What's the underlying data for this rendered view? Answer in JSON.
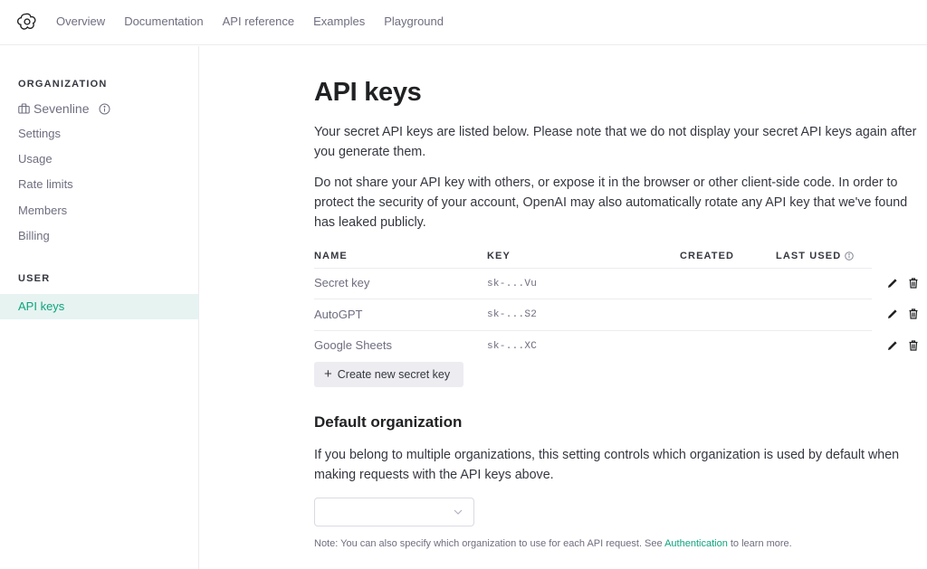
{
  "topbar": {
    "logo": "openai-logo-icon",
    "nav": [
      "Overview",
      "Documentation",
      "API reference",
      "Examples",
      "Playground"
    ]
  },
  "sidebar": {
    "org_heading": "ORGANIZATION",
    "org_name": "Sevenline",
    "org_items": [
      "Settings",
      "Usage",
      "Rate limits",
      "Members",
      "Billing"
    ],
    "user_heading": "USER",
    "user_items": [
      "API keys"
    ],
    "active_item": "API keys"
  },
  "page": {
    "title": "API keys",
    "intro": "Your secret API keys are listed below. Please note that we do not display your secret API keys again after you generate them.",
    "warning": "Do not share your API key with others, or expose it in the browser or other client-side code. In order to protect the security of your account, OpenAI may also automatically rotate any API key that we've found has leaked publicly."
  },
  "keys_table": {
    "columns": [
      "NAME",
      "KEY",
      "CREATED",
      "LAST USED"
    ],
    "rows": [
      {
        "name": "Secret key",
        "key": "sk-...Vu",
        "created": "",
        "last_used": ""
      },
      {
        "name": "AutoGPT",
        "key": "sk-...S2",
        "created": "",
        "last_used": ""
      },
      {
        "name": "Google Sheets",
        "key": "sk-...XC",
        "created": "",
        "last_used": ""
      }
    ],
    "create_button": "Create new secret key"
  },
  "default_org": {
    "heading": "Default organization",
    "description": "If you belong to multiple organizations, this setting controls which organization is used by default when making requests with the API keys above.",
    "select_value": "",
    "note_prefix": "Note: You can also specify which organization to use for each API request. See ",
    "note_link": "Authentication",
    "note_suffix": " to learn more."
  },
  "colors": {
    "accent": "#10a37f",
    "active_bg": "#e6f3f1",
    "border": "#ececf1"
  }
}
